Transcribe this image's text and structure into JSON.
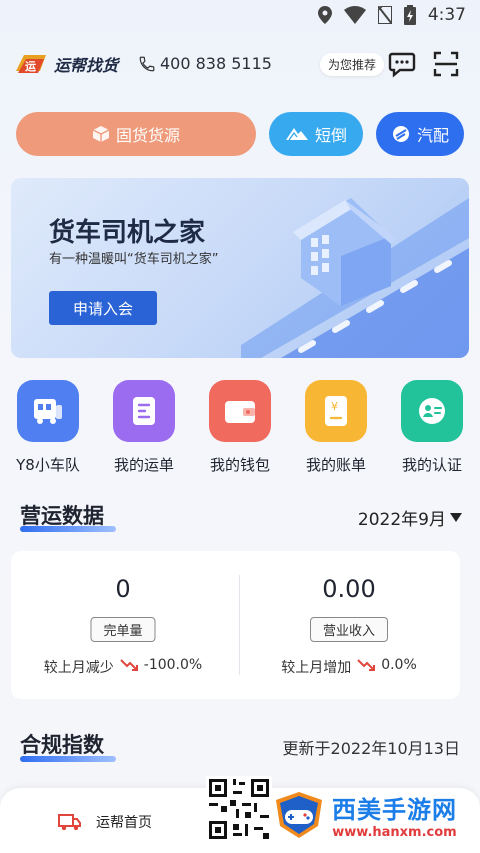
{
  "status_bar": {
    "time": "4:37"
  },
  "header": {
    "logo_text": "运帮找货",
    "phone": "400 838 5115",
    "recommend": "为您推荐"
  },
  "actions": {
    "cargo": "固货货源",
    "short_haul": "短倒",
    "auto_parts": "汽配"
  },
  "banner": {
    "title": "货车司机之家",
    "subtitle": "有一种温暖叫“货车司机之家”",
    "button": "申请入会"
  },
  "quick_menu": [
    {
      "label": "Y8小车队",
      "icon": "truck-fleet-icon",
      "color": "#4f7ff0"
    },
    {
      "label": "我的运单",
      "icon": "waybill-icon",
      "color": "#9b6cf0"
    },
    {
      "label": "我的钱包",
      "icon": "wallet-icon",
      "color": "#f06a5e"
    },
    {
      "label": "我的账单",
      "icon": "bill-icon",
      "color": "#f7b634"
    },
    {
      "label": "我的认证",
      "icon": "id-card-icon",
      "color": "#22c39a"
    }
  ],
  "operations": {
    "title": "营运数据",
    "month": "2022年9月",
    "completed": {
      "value": "0",
      "tag": "完单量",
      "compare_label": "较上月减少",
      "compare_value": "-100.0%"
    },
    "revenue": {
      "value": "0.00",
      "tag": "营业收入",
      "compare_label": "较上月增加",
      "compare_value": "0.0%"
    }
  },
  "compliance": {
    "title": "合规指数",
    "updated": "更新于2022年10月13日"
  },
  "bottom_nav": {
    "home": "运帮首页"
  },
  "watermark": {
    "title": "西美手游网",
    "url": "www.hanxm.com"
  },
  "colors": {
    "accent": "#2e6ff0",
    "cargo": "#ef9a7a",
    "short_haul": "#37a9ee",
    "decline": "#e0463c"
  }
}
